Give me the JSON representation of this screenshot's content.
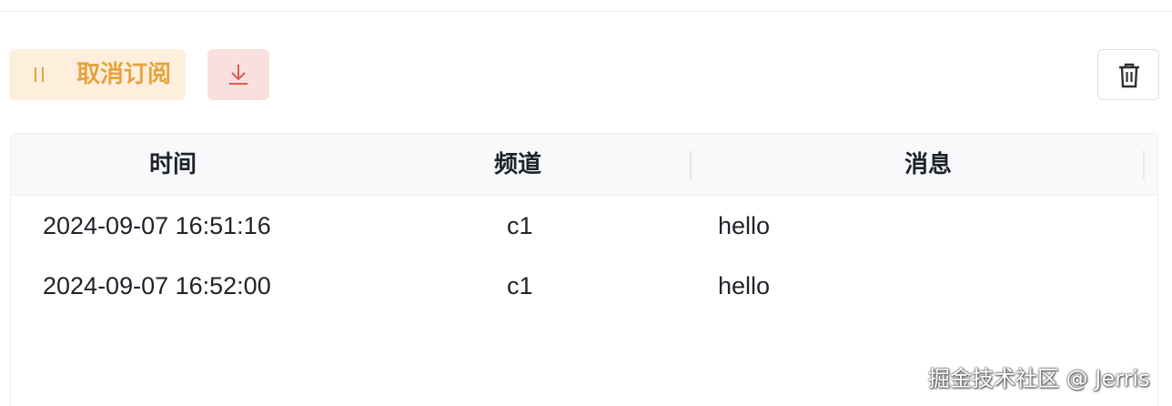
{
  "toolbar": {
    "unsubscribe_label": "取消订阅",
    "download_icon": "download-icon",
    "delete_icon": "trash-icon"
  },
  "colors": {
    "warning": "#e6a23c",
    "warning_bg": "#fdefdc",
    "danger": "#e05a4f",
    "danger_bg": "#f9e0de"
  },
  "table": {
    "headers": [
      "时间",
      "频道",
      "消息"
    ],
    "rows": [
      {
        "time": "2024-09-07 16:51:16",
        "channel": "c1",
        "message": "hello"
      },
      {
        "time": "2024-09-07 16:52:00",
        "channel": "c1",
        "message": "hello"
      }
    ]
  },
  "watermark": "掘金技术社区 @ Jerris"
}
